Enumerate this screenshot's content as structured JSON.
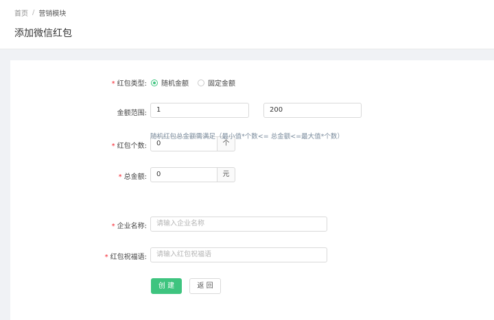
{
  "breadcrumb": {
    "home": "首页",
    "separator": "/",
    "current": "营销模块"
  },
  "page": {
    "title": "添加微信红包"
  },
  "form": {
    "type": {
      "label": "红包类型:",
      "options": [
        "随机金额",
        "固定金额"
      ],
      "selected": "随机金额"
    },
    "amount_range": {
      "label": "金额范围:",
      "min": "1",
      "max": "200"
    },
    "count": {
      "label": "红包个数:",
      "value": "0",
      "unit": "个"
    },
    "total": {
      "label": "总金额:",
      "value": "0",
      "unit": "元"
    },
    "hint": "随机红包总金额需满足（最小值*个数<= 总金额<=最大值*个数）",
    "company": {
      "label": "企业名称:",
      "placeholder": "请输入企业名称"
    },
    "greeting": {
      "label": "红包祝福语:",
      "placeholder": "请输入红包祝福语"
    },
    "required_mark": "*"
  },
  "buttons": {
    "create": "创 建",
    "back": "返 回"
  },
  "colors": {
    "accent": "#3ec47f",
    "required": "#f5222d"
  }
}
